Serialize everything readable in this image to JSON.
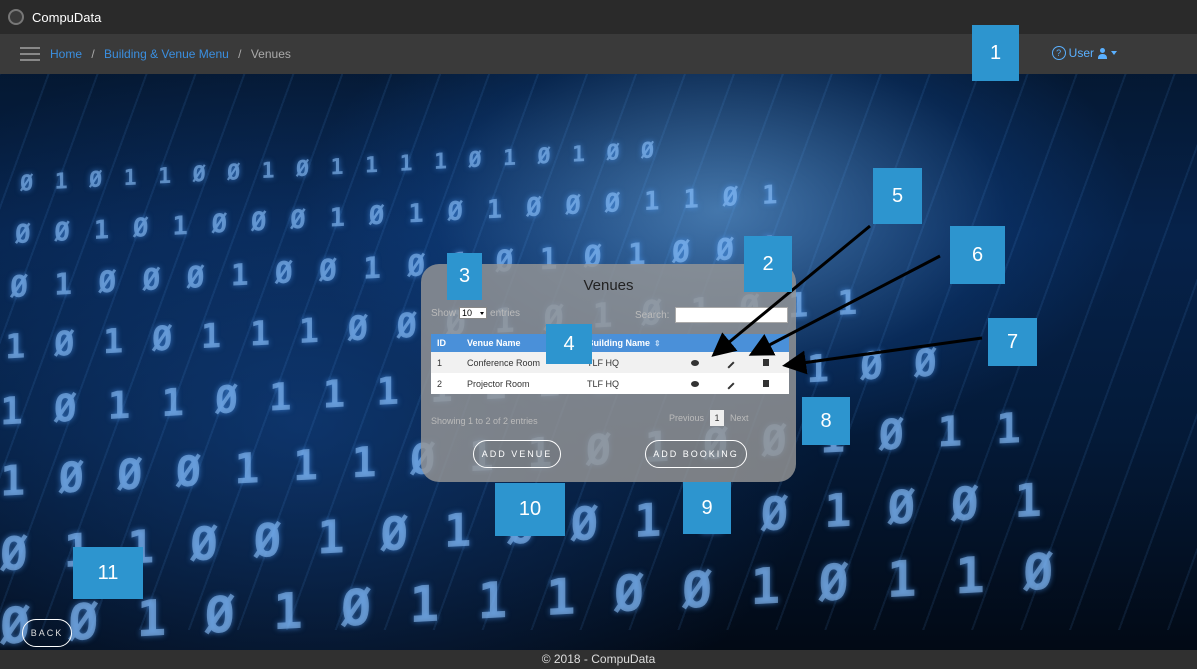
{
  "app": {
    "brand": "CompuData"
  },
  "breadcrumb": {
    "home": "Home",
    "sep": "/",
    "menu": "Building & Venue Menu",
    "current": "Venues"
  },
  "user_menu": {
    "help_glyph": "?",
    "label": "User"
  },
  "panel": {
    "title": "Venues",
    "show_label": "Show",
    "show_value": "10",
    "entries_label": "entries",
    "search_label": "Search:",
    "columns": [
      "ID",
      "Venue Name",
      "Building Name"
    ],
    "rows": [
      {
        "id": "1",
        "venue": "Conference Room",
        "building": "TLF HQ"
      },
      {
        "id": "2",
        "venue": "Projector Room",
        "building": "TLF HQ"
      }
    ],
    "info": "Showing 1 to 2 of 2 entries",
    "pager": {
      "previous": "Previous",
      "page": "1",
      "next": "Next"
    },
    "add_venue": "ADD VENUE",
    "add_booking": "ADD BOOKING"
  },
  "back": "BACK",
  "footer": "© 2018 - CompuData",
  "callouts": [
    "1",
    "2",
    "3",
    "4",
    "5",
    "6",
    "7",
    "8",
    "9",
    "10",
    "11"
  ],
  "icons": [
    "view-icon",
    "edit-icon",
    "delete-icon",
    "help-icon",
    "user-icon",
    "menu-icon"
  ],
  "colors": {
    "callout": "#2d95cf",
    "table_header": "#4a90d9",
    "link": "#3a8fe0"
  }
}
